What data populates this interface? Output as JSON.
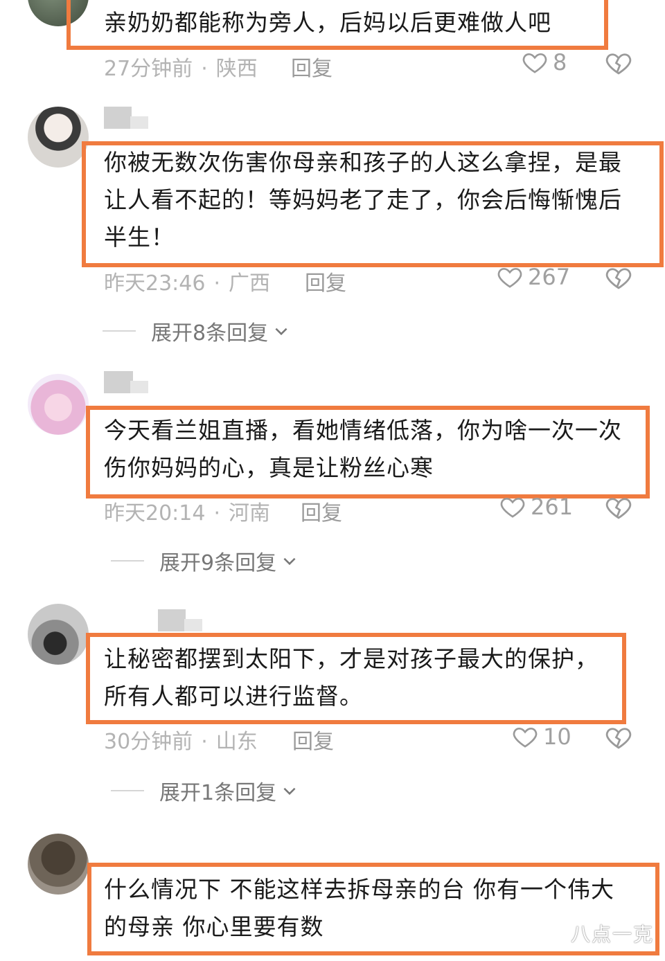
{
  "comments": [
    {
      "text": "亲奶奶都能称为旁人，后妈以后更难做人吧",
      "time": "27分钟前",
      "location": "陕西",
      "reply_label": "回复",
      "likes": "8"
    },
    {
      "text": "你被无数次伤害你母亲和孩子的人这么拿捏，是最让人看不起的！等妈妈老了走了，你会后悔惭愧后半生！",
      "time": "昨天23:46",
      "location": "广西",
      "reply_label": "回复",
      "likes": "267",
      "expand_label": "展开8条回复"
    },
    {
      "text": "今天看兰姐直播，看她情绪低落，你为啥一次一次伤你妈妈的心，真是让粉丝心寒",
      "time": "昨天20:14",
      "location": "河南",
      "reply_label": "回复",
      "likes": "261",
      "expand_label": "展开9条回复"
    },
    {
      "text": "让秘密都摆到太阳下，才是对孩子最大的保护，所有人都可以进行监督。",
      "time": "30分钟前",
      "location": "山东",
      "reply_label": "回复",
      "likes": "10",
      "expand_label": "展开1条回复"
    },
    {
      "text": "什么情况下 不能这样去拆母亲的台 你有一个伟大的母亲 你心里要有数"
    }
  ],
  "watermark": "八点一克",
  "colors": {
    "highlight": "#f07b3f",
    "meta_text": "#b3b3b3"
  }
}
